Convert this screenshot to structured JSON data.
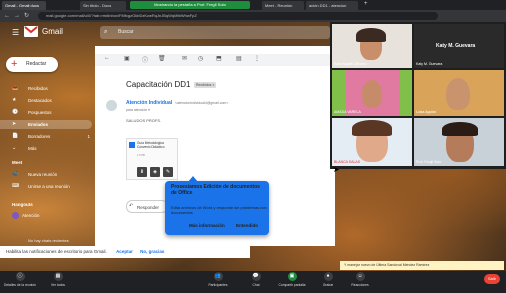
{
  "browser": {
    "tabs": [
      "Gmail - Gmail docs",
      "Sin título - Docs",
      "",
      "Meet - Reunión",
      "ación DD1 - atencion"
    ],
    "share_banner": "Mostrando la pestaña a Prof. Fregli Soto",
    "url": "mail.google.com/mail/u/0/?tab=rm#inbox/FMfcgzGkbDzKzwRqJnJBqWqMtbWhwFpZ",
    "nav_glyphs": [
      "←",
      "→",
      "↻"
    ]
  },
  "gmail": {
    "app_name": "Gmail",
    "search_placeholder": "Buscar",
    "compose_label": "Redactar",
    "nav": [
      {
        "icon": "📥",
        "label": "Recibidos",
        "count": "",
        "selected": false
      },
      {
        "icon": "★",
        "label": "Destacados",
        "count": "",
        "selected": false
      },
      {
        "icon": "🕓",
        "label": "Pospuestos",
        "count": "",
        "selected": false
      },
      {
        "icon": "➤",
        "label": "Enviados",
        "count": "",
        "selected": true
      },
      {
        "icon": "📄",
        "label": "Borradores",
        "count": "1",
        "selected": false
      },
      {
        "icon": "⌄",
        "label": "Más",
        "count": "",
        "selected": false
      }
    ],
    "meet_section": "Meet",
    "meet_items": [
      {
        "icon": "📹",
        "label": "Nueva reunión"
      },
      {
        "icon": "⌨",
        "label": "Unirse a una reunión"
      }
    ],
    "hangouts_section": "Hangouts",
    "hangouts_user": "Atención",
    "no_chats": "No hay chats recientes"
  },
  "email": {
    "subject": "Capacitación DD1",
    "tag": "Recibidos ×",
    "sender": "Atención Individual",
    "sender_email": "<atencionindividual4@gmail.com>",
    "recipient": "para atención  ▾",
    "body": "SALUDOS PROFS.",
    "attachment_name": "Guía Metodológica Convenio Didáctico",
    "attachment_size": "17MB",
    "reply_label": "Responder"
  },
  "tooltip": {
    "title": "Prosesiamos Edición de documentos de Office",
    "body": "Edita archivos de Word y responde sin problemas con documentos",
    "link_more": "Más información",
    "link_ok": "Entendido"
  },
  "meet": {
    "main_name": "Katy M. Guevara",
    "tiles": [
      {
        "name": "Ruth Nayelli Olivarez",
        "skin": "#c98e6a",
        "bg": "#e8e2dc"
      },
      {
        "name": "Katy M. Guevara",
        "skin": "#b4806a",
        "bg": "#2a2a2a"
      },
      {
        "name": "AMADA VARELA",
        "skin": "#c68c69",
        "bg": "#7fbf4a"
      },
      {
        "name": "Luisa Aguilar",
        "skin": "#c9936d",
        "bg": "#d9a45a"
      },
      {
        "name": "BLANCA SALAS",
        "skin": "#e0a98a",
        "bg": "#e4ecf4"
      },
      {
        "name": "Prof. Fregli Soto",
        "skin": "#b57c5c",
        "bg": "#c9d1d8"
      }
    ],
    "notification": "Habilita las notificaciones de escritorio para Gmail.",
    "notif_accept": "Aceptar",
    "notif_no": "No, gracias",
    "caption": "Y manejar nuevo de Última Sandoval Méndez  Ramírez",
    "buttons": [
      "Detalles de la reunión",
      "Ver todos",
      "Participantes",
      "Chat",
      "Compartir pantalla",
      "Grabar",
      "Reacciones"
    ],
    "end_label": "Salir"
  },
  "colors": {
    "accent": "#1a73e8",
    "meet_green": "#1e8e3e",
    "end_red": "#ea4335"
  }
}
